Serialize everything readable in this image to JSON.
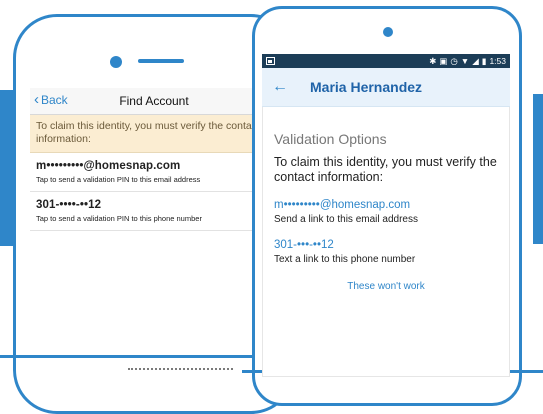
{
  "colors": {
    "brand": "#2f86c9",
    "notice_bg": "#fbedd2",
    "status_bar": "#1c3d57"
  },
  "ios": {
    "back_label": "Back",
    "title": "Find Account",
    "notice": "To claim this identity, you must verify the contact information:",
    "options": [
      {
        "value": "m•••••••••@homesnap.com",
        "hint": "Tap to send a validation PIN to this email address"
      },
      {
        "value": "301-••••-••12",
        "hint": "Tap to send a validation PIN to this phone number"
      }
    ]
  },
  "android": {
    "status": {
      "time": "1:53"
    },
    "app_bar_title": "Maria Hernandez",
    "heading": "Validation Options",
    "message": "To claim this identity, you must verify the contact information:",
    "options": [
      {
        "value": "m•••••••••@homesnap.com",
        "desc": "Send a link to this email address"
      },
      {
        "value": "301-•••-••12",
        "desc": "Text a link to this phone number"
      }
    ],
    "wont_work": "These won't work"
  }
}
